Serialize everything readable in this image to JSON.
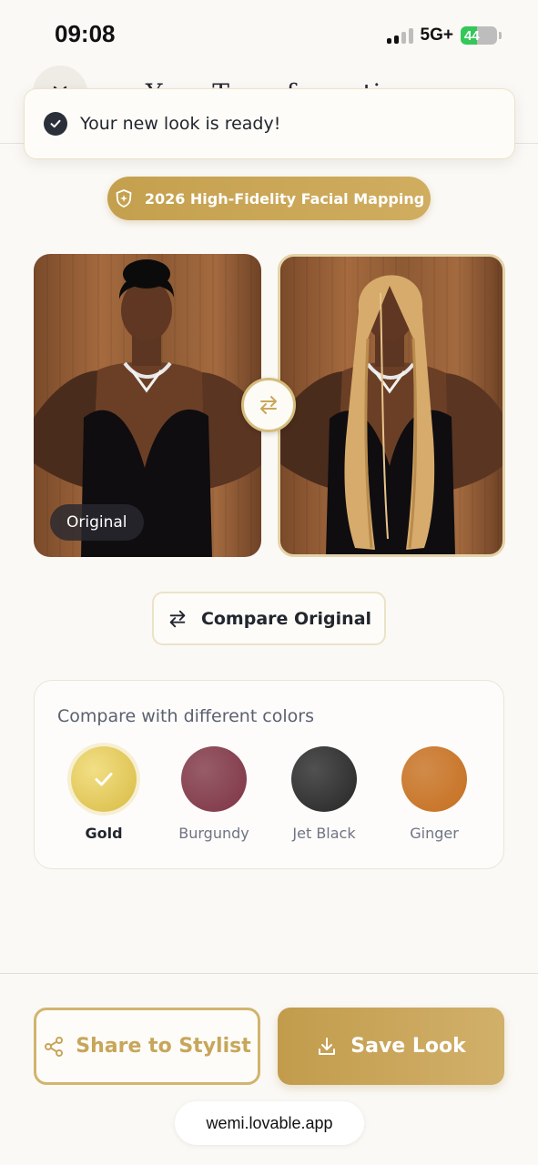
{
  "status_bar": {
    "time": "09:08",
    "network": "5G+",
    "battery": "44",
    "battery_level": 0.44
  },
  "header": {
    "title": "Your Transformation",
    "back_icon": "close-icon"
  },
  "toast": {
    "message": "Your new look is ready!",
    "icon": "check-circle-icon"
  },
  "badge": {
    "label": "2026 High-Fidelity Facial Mapping",
    "icon": "shield-sparkle-icon"
  },
  "photos": {
    "original_label": "Original",
    "swap_icon": "swap-arrows-icon"
  },
  "compare_button": {
    "label": "Compare Original",
    "icon": "swap-arrows-icon"
  },
  "colors": {
    "title": "Compare with different colors",
    "options": [
      {
        "name": "Gold",
        "color": "#e3c95a",
        "selected": true
      },
      {
        "name": "Burgundy",
        "color": "#7e3444",
        "selected": false
      },
      {
        "name": "Jet Black",
        "color": "#262626",
        "selected": false
      },
      {
        "name": "Ginger",
        "color": "#c66f1e",
        "selected": false
      }
    ]
  },
  "actions": {
    "share_label": "Share to Stylist",
    "share_icon": "share-icon",
    "save_label": "Save Look",
    "save_icon": "download-icon"
  },
  "browser": {
    "url": "wemi.lovable.app"
  },
  "theme": {
    "accent": "#c9a75a",
    "background": "#fbf9f6"
  }
}
